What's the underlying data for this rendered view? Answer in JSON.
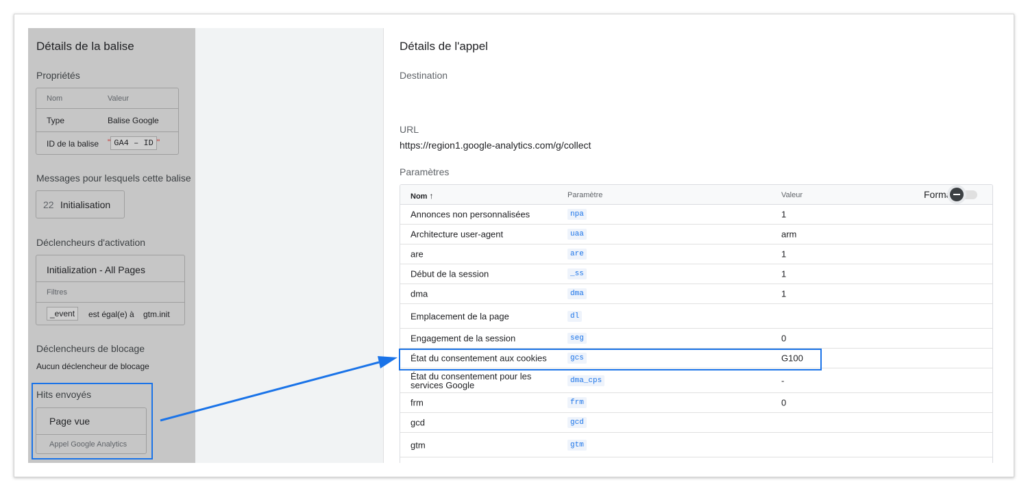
{
  "left": {
    "title": "Détails de la balise",
    "properties_heading": "Propriétés",
    "properties_table": {
      "col_name": "Nom",
      "col_value": "Valeur",
      "rows": [
        {
          "name": "Type",
          "value": "Balise Google"
        },
        {
          "name": "ID de la balise",
          "value": "GA4 – ID"
        }
      ]
    },
    "messages_heading": "Messages pour lesquels cette balise",
    "message_chip": {
      "number": "22",
      "label": "Initialisation"
    },
    "firing_heading": "Déclencheurs d'activation",
    "trigger": {
      "name": "Initialization - All Pages",
      "filters_label": "Filtres",
      "filter_var": "_event",
      "filter_op": "est égal(e) à",
      "filter_value": "gtm.init"
    },
    "blocking_heading": "Déclencheurs de blocage",
    "blocking_text": "Aucun déclencheur de blocage",
    "hits_heading": "Hits envoyés",
    "hit": {
      "title": "Page vue",
      "subtitle": "Appel Google Analytics"
    }
  },
  "right": {
    "title": "Détails de l'appel",
    "destination_label": "Destination",
    "url_label": "URL",
    "url_value": "https://region1.google-analytics.com/g/collect",
    "params_label": "Paramètres",
    "table": {
      "col_name": "Nom",
      "col_name_sort_icon": "arrow-up-icon",
      "col_param": "Paramètre",
      "col_value": "Valeur",
      "format_label": "Format",
      "rows": [
        {
          "name": "Annonces non personnalisées",
          "param": "npa",
          "value": "1"
        },
        {
          "name": "Architecture user-agent",
          "param": "uaa",
          "value": "arm"
        },
        {
          "name": "are",
          "param": "are",
          "value": "1"
        },
        {
          "name": "Début de la session",
          "param": "_ss",
          "value": "1"
        },
        {
          "name": "dma",
          "param": "dma",
          "value": "1"
        },
        {
          "name": "Emplacement de la page",
          "param": "dl",
          "value": ""
        },
        {
          "name": "Engagement de la session",
          "param": "seg",
          "value": "0"
        },
        {
          "name": "État du consentement aux cookies",
          "param": "gcs",
          "value": "G100"
        },
        {
          "name": "État du consentement pour les services Google",
          "param": "dma_cps",
          "value": "-"
        },
        {
          "name": "frm",
          "param": "frm",
          "value": "0"
        },
        {
          "name": "gcd",
          "param": "gcd",
          "value": ""
        },
        {
          "name": "gtm",
          "param": "gtm",
          "value": ""
        }
      ]
    }
  },
  "colors": {
    "highlight": "#1a73e8",
    "overlay": "#c6c6c6"
  }
}
